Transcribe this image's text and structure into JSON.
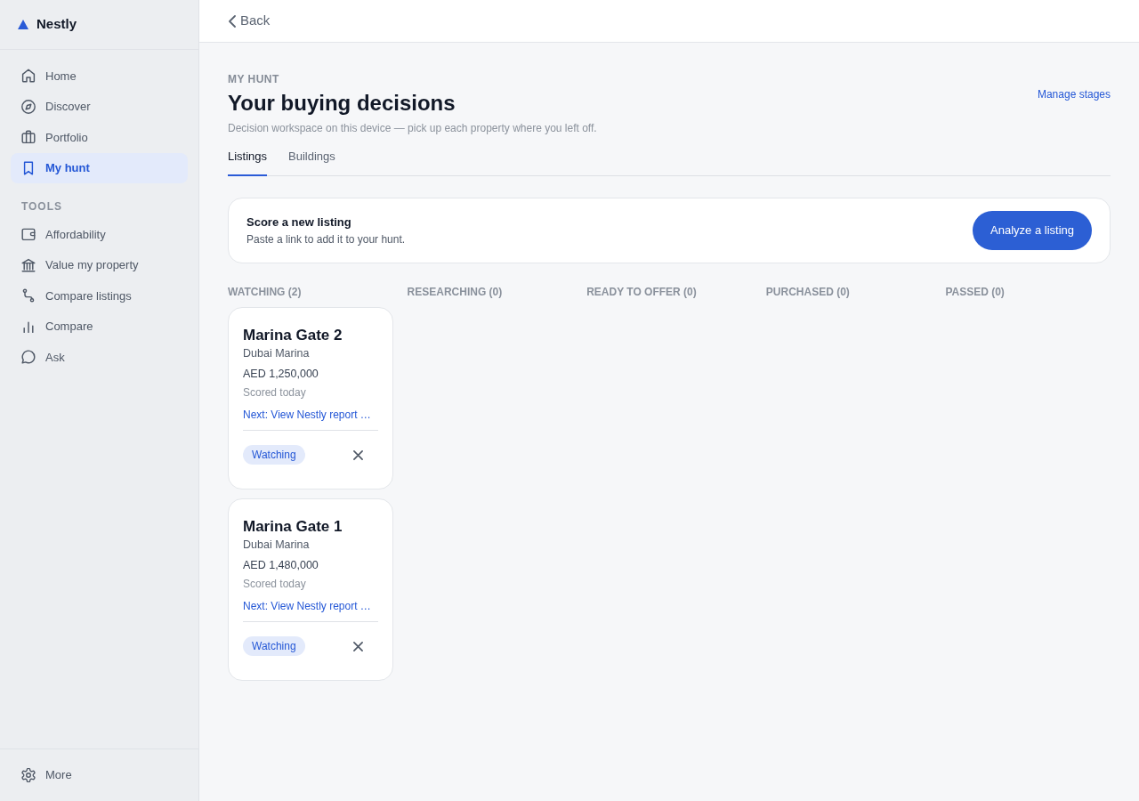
{
  "brand": {
    "name": "Nestly"
  },
  "sidebar": {
    "items": [
      {
        "label": "Home",
        "selected": false
      },
      {
        "label": "Discover",
        "selected": false
      },
      {
        "label": "Portfolio",
        "selected": false
      },
      {
        "label": "My hunt",
        "selected": true
      }
    ],
    "tools": {
      "heading": "TOOLS",
      "items": [
        {
          "label": "Affordability",
          "selected": false
        },
        {
          "label": "Value my property",
          "selected": false
        },
        {
          "label": "Compare listings",
          "selected": false
        },
        {
          "label": "Compare",
          "selected": false
        },
        {
          "label": "Ask",
          "selected": false
        }
      ]
    },
    "footer_items": [
      {
        "label": "More",
        "selected": false
      }
    ]
  },
  "header": {
    "back_label": "Back"
  },
  "page": {
    "eyebrow": "MY HUNT",
    "title": "Your buying decisions",
    "subtitle": "Decision workspace on this device — pick up each property where you left off.",
    "manage_link": "Manage stages"
  },
  "tabs": [
    {
      "label": "Listings",
      "selected": true
    },
    {
      "label": "Buildings",
      "selected": false
    }
  ],
  "score_card": {
    "title": "Score a new listing",
    "description": "Paste a link to add it to your hunt.",
    "button": "Analyze a listing"
  },
  "board": {
    "columns": [
      {
        "title": "WATCHING (2)",
        "cards": [
          {
            "name": "Marina Gate 2",
            "area": "Dubai Marina",
            "price": "AED 1,250,000",
            "scored": "Scored today",
            "next_step": "Next: View Nestly report …",
            "status": "Watching"
          },
          {
            "name": "Marina Gate 1",
            "area": "Dubai Marina",
            "price": "AED 1,480,000",
            "scored": "Scored today",
            "next_step": "Next: View Nestly report …",
            "status": "Watching"
          }
        ]
      },
      {
        "title": "RESEARCHING (0)"
      },
      {
        "title": "READY TO OFFER (0)"
      },
      {
        "title": "PURCHASED (0)"
      },
      {
        "title": "PASSED (0)"
      }
    ]
  }
}
